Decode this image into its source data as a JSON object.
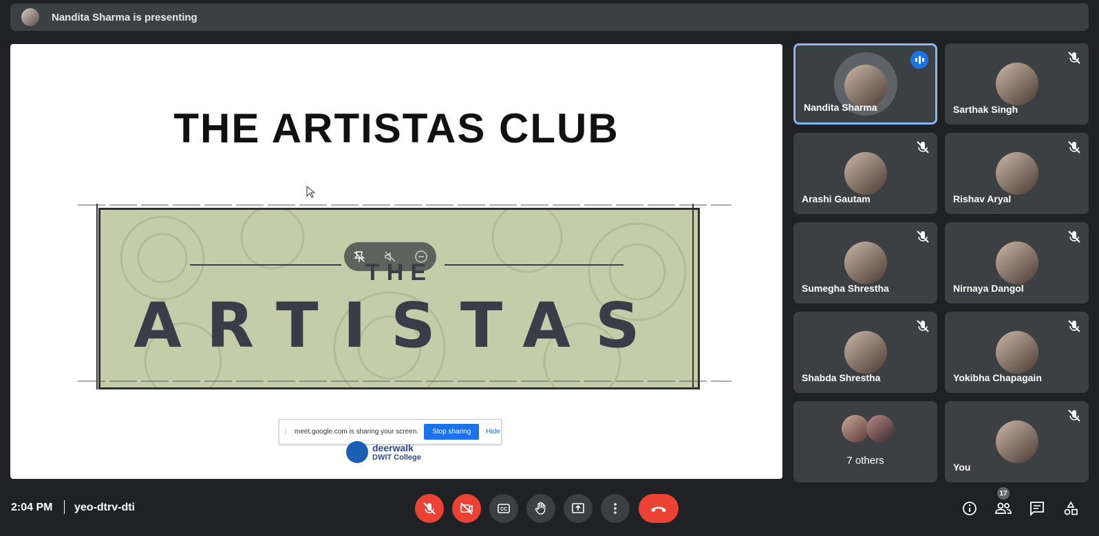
{
  "banner": {
    "presenting_text": "Nandita Sharma is presenting"
  },
  "slide": {
    "title": "THE ARTISTAS CLUB",
    "art_the": "THE",
    "art_name": "ARTISTAS",
    "share_bar": {
      "message": "meet.google.com is sharing your screen.",
      "stop": "Stop sharing",
      "hide": "Hide"
    },
    "logo": {
      "line1": "deerwalk",
      "line2": "DWIT College"
    }
  },
  "participants": [
    {
      "name": "Nandita Sharma",
      "speaking": true
    },
    {
      "name": "Sarthak Singh",
      "muted": true
    },
    {
      "name": "Arashi Gautam",
      "muted": true
    },
    {
      "name": "Rishav Aryal",
      "muted": true
    },
    {
      "name": "Sumegha Shrestha",
      "muted": true
    },
    {
      "name": "Nirnaya Dangol",
      "muted": true
    },
    {
      "name": "Shabda Shrestha",
      "muted": true
    },
    {
      "name": "Yokibha Chapagain",
      "muted": true
    },
    {
      "name": "7 others"
    },
    {
      "name": "You",
      "muted": true
    }
  ],
  "footer": {
    "time": "2:04 PM",
    "meeting_code": "yeo-dtrv-dti",
    "participant_count": "17"
  },
  "icons": [
    "mic-off-icon",
    "camera-off-icon",
    "captions-icon",
    "raise-hand-icon",
    "present-icon",
    "more-icon",
    "end-call-icon",
    "info-icon",
    "people-icon",
    "chat-icon",
    "activities-icon"
  ],
  "colors": {
    "accent": "#8ab4f8",
    "danger": "#ea4335",
    "tile": "#3c4043",
    "bg": "#202124",
    "speaking": "#1a73e8"
  }
}
